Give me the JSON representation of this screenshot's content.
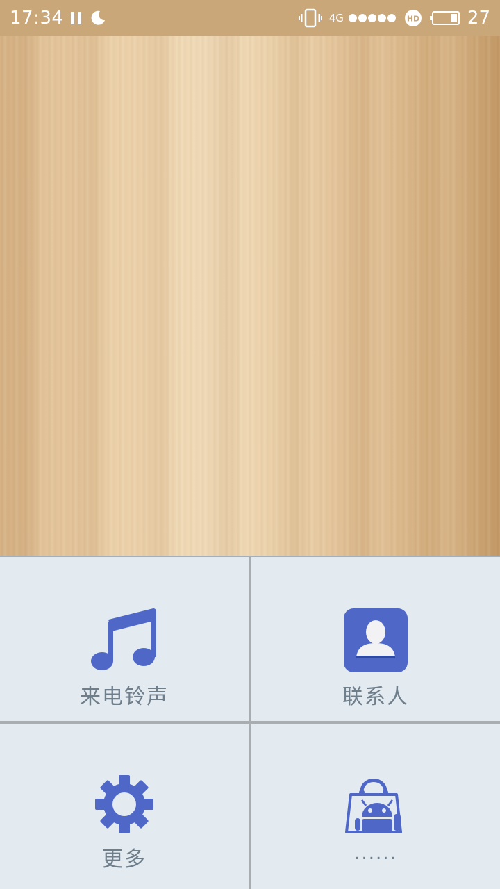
{
  "status_bar": {
    "time": "17:34",
    "network": "4G",
    "battery_level": "27",
    "icons": [
      "pause-icon",
      "moon-icon",
      "vibrate-icon",
      "signal-dots-icon",
      "hd-icon",
      "battery-icon"
    ]
  },
  "wallpaper": {
    "style": "light-wood"
  },
  "tiles": [
    {
      "label": "来电铃声",
      "icon": "music-note-icon"
    },
    {
      "label": "联系人",
      "icon": "contact-icon"
    },
    {
      "label": "更多",
      "icon": "gear-icon"
    },
    {
      "label": "......",
      "icon": "android-shopping-bag-icon"
    }
  ],
  "colors": {
    "status_bar": "#c9a779",
    "accent": "#4f68c8",
    "tile_bg": "#e3ebf1",
    "divider": "#a8adb1",
    "label": "#6f7e8b"
  }
}
